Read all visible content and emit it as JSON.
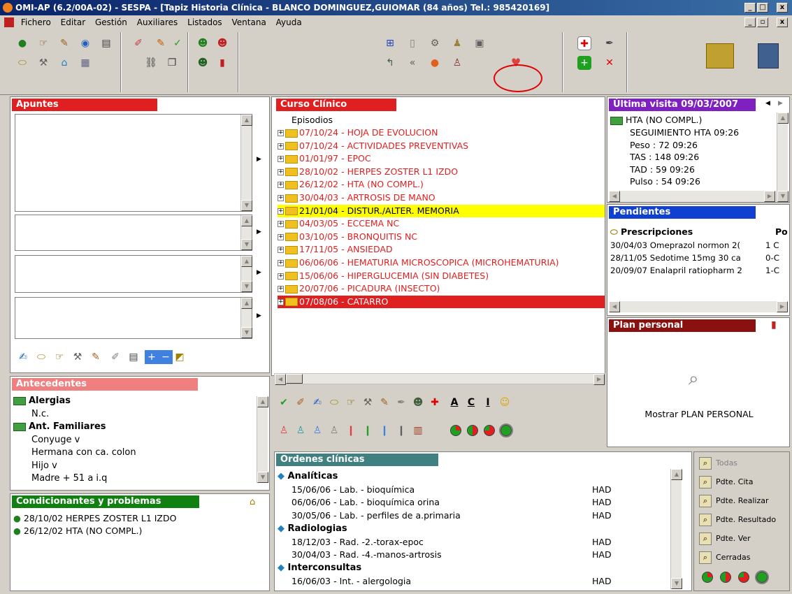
{
  "window": {
    "title": "OMI-AP (6.2/00A-02) - SESPA - [Tapiz Historia Clínica - BLANCO DOMINGUEZ,GUIOMAR (84 años) Tel.: 985420169]",
    "min": "_",
    "max": "□",
    "close": "x",
    "child_min": "_",
    "child_max": "▫",
    "child_close": "x"
  },
  "menu": [
    "Fichero",
    "Editar",
    "Gestión",
    "Auxiliares",
    "Listados",
    "Ventana",
    "Ayuda"
  ],
  "apuntes": {
    "title": "Apuntes"
  },
  "curso": {
    "title": "Curso Clínico",
    "root": "Episodios",
    "episodes": [
      "07/10/24 - HOJA DE EVOLUCION",
      "07/10/24 - ACTIVIDADES PREVENTIVAS",
      "01/01/97 - EPOC",
      "28/10/02 - HERPES ZOSTER L1 IZDO",
      "26/12/02 - HTA (NO COMPL.)",
      "30/04/03 - ARTROSIS DE MANO",
      "21/01/04 - DISTUR./ALTER. MEMORIA",
      "04/03/05 - ECCEMA NC",
      "03/10/05 - BRONQUITIS NC",
      "17/11/05 - ANSIEDAD",
      "06/06/06 - HEMATURIA MICROSCOPICA (MICROHEMATURIA)",
      "15/06/06 - HIPERGLUCEMIA (SIN DIABETES)",
      "20/07/06 - PICADURA (INSECTO)",
      "07/08/06 - CATARRO"
    ],
    "styling_letters": [
      "A",
      "C",
      "I"
    ]
  },
  "ultima": {
    "title": "Última visita 09/03/2007",
    "header": "HTA  (NO COMPL.)",
    "lines": [
      "SEGUIMIENTO HTA 09:26",
      "Peso : 72 09:26",
      "TAS : 148 09:26",
      "TAD : 59 09:26",
      "Pulso : 54 09:26"
    ]
  },
  "pendientes": {
    "title": "Pendientes",
    "col1": "Prescripciones",
    "col2": "Po",
    "rows": [
      {
        "text": "30/04/03 Omeprazol normon 2(",
        "dose": "1 C"
      },
      {
        "text": "28/11/05 Sedotime 15mg 30 ca",
        "dose": "0-C"
      },
      {
        "text": "20/09/07 Enalapril ratiopharm 2",
        "dose": "1-C"
      }
    ]
  },
  "plan": {
    "title": "Plan personal",
    "show": "Mostrar PLAN PERSONAL"
  },
  "antecedentes": {
    "title": "Antecedentes",
    "items": [
      {
        "text": "Alergias",
        "bold": true
      },
      {
        "text": "N.c.",
        "bold": false
      },
      {
        "text": "Ant. Familiares",
        "bold": true
      },
      {
        "text": "Conyuge v",
        "bold": false
      },
      {
        "text": "Hermana con ca. colon",
        "bold": false
      },
      {
        "text": "Hijo v",
        "bold": false
      },
      {
        "text": "Madre + 51 a i.q",
        "bold": false
      }
    ]
  },
  "condicionantes": {
    "title": "Condicionantes y problemas",
    "items": [
      "28/10/02  HERPES ZOSTER L1 IZDO",
      "26/12/02  HTA  (NO COMPL.)"
    ]
  },
  "ordenes": {
    "title": "Ordenes clínicas",
    "rows": [
      {
        "text": "Analíticas",
        "col": "",
        "group": true
      },
      {
        "text": "15/06/06 - Lab. - bioquímica",
        "col": "HAD",
        "group": false
      },
      {
        "text": "06/06/06 - Lab. - bioquímica orina",
        "col": "HAD",
        "group": false
      },
      {
        "text": "30/05/06 - Lab. - perfiles de a.primaria",
        "col": "HAD",
        "group": false
      },
      {
        "text": "Radiologias",
        "col": "",
        "group": true
      },
      {
        "text": "18/12/03 - Rad. -2.-torax-epoc",
        "col": "HAD",
        "group": false
      },
      {
        "text": "30/04/03 - Rad. -4.-manos-artrosis",
        "col": "HAD",
        "group": false
      },
      {
        "text": "Interconsultas",
        "col": "",
        "group": true
      },
      {
        "text": "16/06/03 - Int. - alergologia",
        "col": "HAD",
        "group": false
      }
    ]
  },
  "filters": [
    "Todas",
    "Pdte. Cita",
    "Pdte. Realizar",
    "Pdte. Resultado",
    "Pdte. Ver",
    "Cerradas"
  ],
  "colors": {
    "title_bar": "#0a246a",
    "apuntes_head": "#e02020",
    "curso_head": "#e02020",
    "ultima_head": "#8020c0",
    "pendientes_head": "#1040d0",
    "plan_head": "#8b1010",
    "antecedentes_head": "#f08080",
    "condicionantes_head": "#108010",
    "ordenes_head": "#408080",
    "episode_text": "#e02020",
    "selected_row": "#ffff00",
    "active_row": "#e02020"
  }
}
